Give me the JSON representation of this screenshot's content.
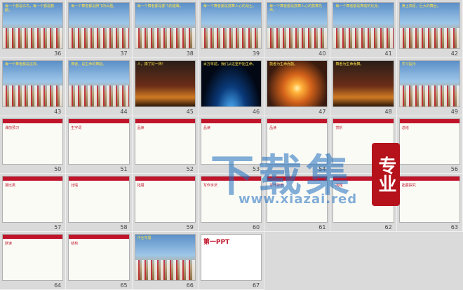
{
  "slides": [
    {
      "num": "36",
      "style": "photo",
      "text": "每一个都是白鸟，每一个都是鹏鹏。"
    },
    {
      "num": "37",
      "style": "photo",
      "text": "每一个舞者都是腾飞的凤凰。"
    },
    {
      "num": "38",
      "style": "photo",
      "text": "每一个舞者都是都飞的雄鹰。"
    },
    {
      "num": "39",
      "style": "photo",
      "text": "每一个舞者都是鼓舞人心的战士。"
    },
    {
      "num": "40",
      "style": "photo",
      "text": "每一个舞者都是鼓舞人心的鼓舞先声。"
    },
    {
      "num": "41",
      "style": "photo",
      "text": "每一个舞者都是舞者的化身。"
    },
    {
      "num": "42",
      "style": "photo",
      "text": "黄土高原，巨大的舞台。"
    },
    {
      "num": "43",
      "style": "photo",
      "text": "每一个舞者都是这样。"
    },
    {
      "num": "44",
      "style": "photo",
      "text": "舞者，是生命的舞蹈。"
    },
    {
      "num": "45",
      "style": "dark",
      "text": "人，搏了好一阵！"
    },
    {
      "num": "46",
      "style": "space",
      "text": "百万年前，我们从这里开始生命。"
    },
    {
      "num": "47",
      "style": "sunset",
      "text": "鼓者为生命而鼓。"
    },
    {
      "num": "48",
      "style": "dark",
      "text": "舞者为生命而舞。"
    },
    {
      "num": "49",
      "style": "photo",
      "text": "学习提示"
    },
    {
      "num": "50",
      "style": "text",
      "text": "课前预习"
    },
    {
      "num": "51",
      "style": "text",
      "text": "生字词"
    },
    {
      "num": "52",
      "style": "text",
      "text": "品读"
    },
    {
      "num": "53",
      "style": "text",
      "text": "品读"
    },
    {
      "num": "54",
      "style": "text",
      "text": "品读"
    },
    {
      "num": "55",
      "style": "text",
      "text": "赏析"
    },
    {
      "num": "56",
      "style": "text",
      "text": "总结"
    },
    {
      "num": "57",
      "style": "text",
      "text": "排比类"
    },
    {
      "num": "58",
      "style": "text",
      "text": "比喻"
    },
    {
      "num": "59",
      "style": "text",
      "text": "拓展"
    },
    {
      "num": "60",
      "style": "text",
      "text": "写作手法"
    },
    {
      "num": "61",
      "style": "text",
      "text": "写作背景"
    },
    {
      "num": "62",
      "style": "text",
      "text": "问题"
    },
    {
      "num": "63",
      "style": "text",
      "text": "拓展探究"
    },
    {
      "num": "64",
      "style": "text",
      "text": "默读"
    },
    {
      "num": "65",
      "style": "text",
      "text": "结构"
    },
    {
      "num": "66",
      "style": "photo",
      "text": "作业布置"
    },
    {
      "num": "67",
      "style": "ppt",
      "text": "第一PPT"
    }
  ],
  "watermark": {
    "title": "下载集",
    "url": "www.xiazai.red",
    "seal": "专业"
  }
}
